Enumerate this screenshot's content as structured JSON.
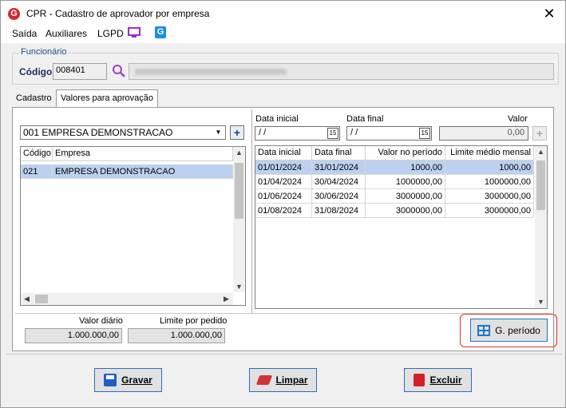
{
  "window": {
    "title": "CPR - Cadastro de aprovador por empresa",
    "logo": "G",
    "close": "✕"
  },
  "menu": {
    "items": [
      "Saída",
      "Auxiliares",
      "LGPD"
    ],
    "g_icon": "G"
  },
  "funcionario": {
    "legend": "Funcionário",
    "codigo_label": "Código",
    "codigo_value": "008401"
  },
  "tabs": [
    "Cadastro",
    "Valores para aprovação"
  ],
  "empresa": {
    "selected": "001 EMPRESA DEMONSTRACAO",
    "columns": [
      "Código",
      "Empresa"
    ],
    "rows": [
      {
        "codigo": "021",
        "empresa": "EMPRESA DEMONSTRACAO"
      }
    ]
  },
  "filters": {
    "data_inicial_label": "Data inicial",
    "data_final_label": "Data final",
    "valor_label": "Valor",
    "data_inicial": " / /",
    "data_final": " / /",
    "valor": "0,00",
    "cal_label": "15"
  },
  "periodos": {
    "columns": [
      "Data inicial",
      "Data final",
      "Valor no período",
      "Limite médio mensal"
    ],
    "rows": [
      {
        "ini": "01/01/2024",
        "fim": "31/01/2024",
        "valor": "1000,00",
        "limite": "1000,00"
      },
      {
        "ini": "01/04/2024",
        "fim": "30/04/2024",
        "valor": "1000000,00",
        "limite": "1000000,00"
      },
      {
        "ini": "01/06/2024",
        "fim": "30/06/2024",
        "valor": "3000000,00",
        "limite": "3000000,00"
      },
      {
        "ini": "01/08/2024",
        "fim": "31/08/2024",
        "valor": "3000000,00",
        "limite": "3000000,00"
      }
    ]
  },
  "totais": {
    "valor_diario_label": "Valor diário",
    "valor_diario": "1.000.000,00",
    "limite_pedido_label": "Limite por pedido",
    "limite_pedido": "1.000.000,00"
  },
  "buttons": {
    "g_periodo": "G. período",
    "gravar": "Gravar",
    "limpar": "Limpar",
    "excluir": "Excluir"
  }
}
